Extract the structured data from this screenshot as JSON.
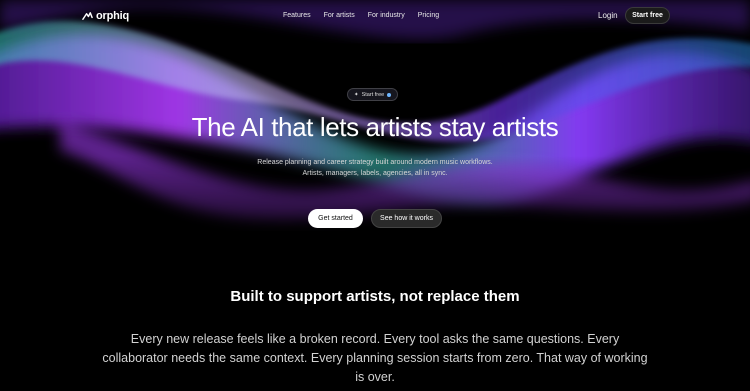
{
  "brand": {
    "name": "orphiq"
  },
  "nav": {
    "links": [
      "Features",
      "For artists",
      "For industry",
      "Pricing"
    ],
    "login": "Login",
    "cta": "Start free"
  },
  "hero": {
    "badge": "Start free",
    "title": "The AI that lets artists stay artists",
    "subtitle_line1": "Release planning and career strategy built around modern music workflows.",
    "subtitle_line2": "Artists, managers, labels, agencies, all in sync.",
    "primary_button": "Get started",
    "secondary_button": "See how it works"
  },
  "section": {
    "title": "Built to support artists, not replace them",
    "body": "Every new release feels like a broken record. Every tool asks the same questions. Every collaborator needs the same context. Every planning session starts from zero. That way of working is over."
  },
  "colors": {
    "background": "#000000",
    "wave_purple": "#7b3cff",
    "wave_teal": "#3fd6c4",
    "wave_magenta": "#c63cff"
  }
}
